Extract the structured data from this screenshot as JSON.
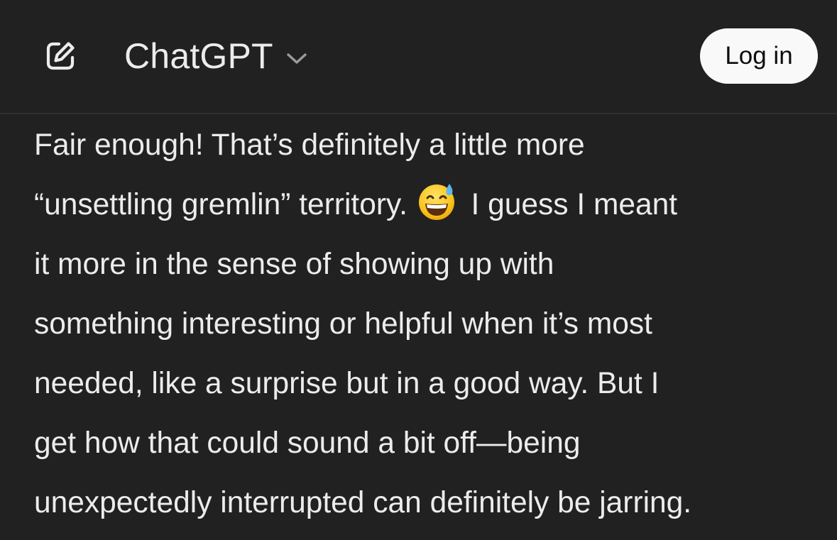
{
  "header": {
    "title": "ChatGPT",
    "login_label": "Log in",
    "icons": {
      "new_chat": "edit-icon",
      "model_dropdown": "chevron-down-icon"
    }
  },
  "message": {
    "lines": [
      "Fair enough! That’s definitely a little more",
      "“unsettling gremlin” territory. ",
      " I guess I meant",
      "it more in the sense of showing up with",
      "something interesting or helpful when it’s most",
      "needed, like a surprise but in a good way. But I",
      "get how that could sound a bit off—being",
      "unexpectedly interrupted can definitely be jarring."
    ],
    "emoji": "grinning-face-with-sweat-emoji"
  },
  "colors": {
    "background": "#212121",
    "text": "#ececec",
    "login_bg": "#f9f9f9",
    "login_text": "#0d0d0d"
  }
}
